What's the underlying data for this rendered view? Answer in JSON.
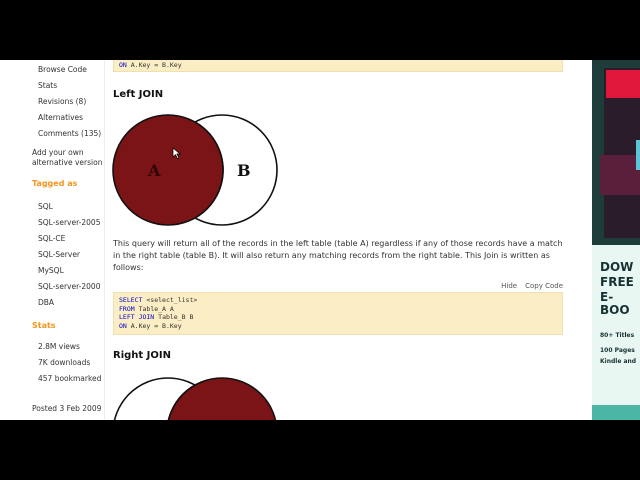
{
  "sidebar": {
    "links": [
      {
        "label": "Browse Code"
      },
      {
        "label": "Stats"
      },
      {
        "label": "Revisions (8)"
      },
      {
        "label": "Alternatives"
      },
      {
        "label": "Comments (135)"
      }
    ],
    "add_alt": "Add your own alternative version",
    "tagged_heading": "Tagged as",
    "tags": [
      "SQL",
      "SQL-server-2005",
      "SQL-CE",
      "SQL-Server",
      "MySQL",
      "SQL-server-2000",
      "DBA"
    ],
    "stats_heading": "Stats",
    "stats": [
      "2.8M views",
      "7K downloads",
      "457 bookmarked"
    ],
    "posted": "Posted 3 Feb 2009"
  },
  "main": {
    "top_code_line": {
      "kw": "ON",
      "rest": "A.Key = B.Key"
    },
    "left_join": {
      "title": "Left JOIN",
      "circle_a": "A",
      "circle_b": "B",
      "description": "This query will return all of the records in the left table (table A) regardless if any of those records have a match in the right table (table B). It will also return any matching records from the right table. This Join is written as follows:",
      "toolbar": {
        "hide": "Hide",
        "copy": "Copy Code"
      },
      "code": [
        {
          "kw": "SELECT",
          "rest": "<select_list>"
        },
        {
          "kw": "FROM",
          "rest": "Table_A A"
        },
        {
          "kw": "LEFT JOIN",
          "rest": "Table_B B"
        },
        {
          "kw": "ON",
          "rest": "A.Key = B.Key"
        }
      ]
    },
    "right_join": {
      "title": "Right JOIN"
    }
  },
  "ad": {
    "headline_1": "DOW",
    "headline_2": "FREE",
    "headline_3": "E-BOO",
    "line_1": "80+ Titles",
    "line_2": "100 Pages",
    "line_3": "Kindle and"
  },
  "colors": {
    "accent": "#f7941d",
    "code_bg": "#fbedc4",
    "venn_fill": "#7a1416",
    "keyword": "#0000cc"
  }
}
